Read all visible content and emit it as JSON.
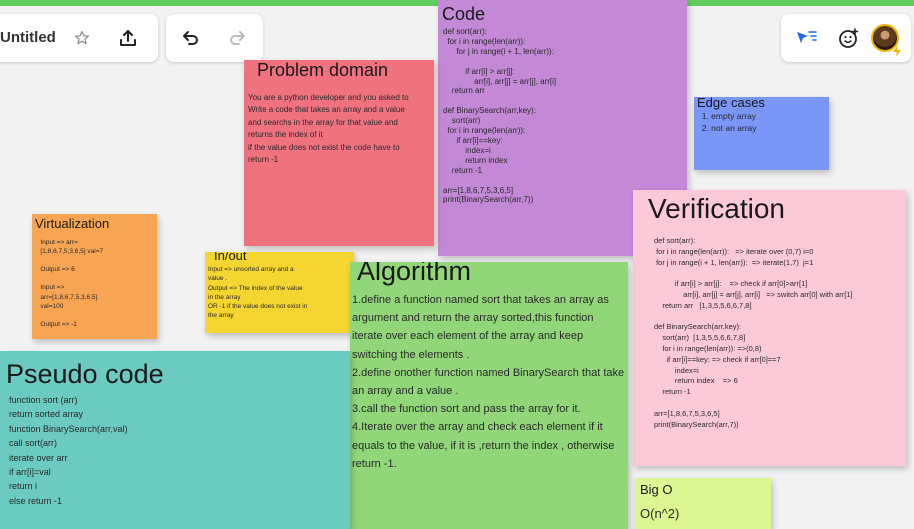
{
  "toolbar": {
    "board_title": "Untitled"
  },
  "notes": {
    "code": {
      "title": "Code",
      "body": "def sort(arr):\n  for i in range(len(arr)):\n      for j in range(i + 1, len(arr)):\n\n          if arr[i] > arr[j]:\n              arr[i], arr[j] = arr[j], arr[i]\n    return arr\n\ndef BinarySearch(arr,key):\n    sort(arr)\n  for i in range(len(arr)):\n      if arr[i]==key:\n          index=i\n          return index\n    return -1\n\narr=[1,8,6,7,5,3,6,5]\nprint(BinarySearch(arr,7))"
    },
    "problem": {
      "title": "Problem domain",
      "body": "You are a python developer and you asked to\nWrite a code that takes an array and a value\nand searchs in the array for that value and\nreturns the index of it\nif the value does not exist the code have to\nreturn -1"
    },
    "edge": {
      "title": "Edge cases",
      "body": "  1. empty array\n  2. not an array"
    },
    "virtualization": {
      "title": "Virtualization",
      "body": "   Input => arr=\n   [1,8,6,7,5,3,6,5] val=7\n\n   Output => 6\n\n   Input =>\n   arr=[1,8,6,7,5,3,6,5]\n   val=100\n\n   Output => -1"
    },
    "inout": {
      "title": "In/out",
      "body": "Input => unsorted array and a\nvalue .\nOutput => The index of the value\nin the array\nOR -1 if the value does not exist in\nthe array"
    },
    "algorithm": {
      "title": "Algorithm",
      "body": "1.define a function named sort that takes an array as argument and return the array sorted,this function iterate over each element of the array and keep switching the elements .\n2.define onother function named BinarySearch that take an array and a value .\n3.call the function sort and pass the array for it.\n4.Iterate over the array and check each element if it equals to the value, if it is ,return the index , otherwise return -1."
    },
    "verification": {
      "title": "Verification",
      "body": "def sort(arr):\n for i in range(len(arr)):   => iterate over (0,7) i=0\n for j in range(i + 1, len(arr)):  => iterate(1,7)  j=1\n\n          if arr[i] > arr[j]:    => check if arr[0]>arr[1]\n              arr[i], arr[j] = arr[j], arr[i]   => switch arr[0] with arr[1]\n    return arr   [1,3,5,5,6,6,7,8]\n\ndef BinarySearch(arr,key):\n    sort(arr)  [1,3,5,5,6,6,7,8]\n    for i in range(len(arr)): =>(0,8)\n      if arr[i]==key: => check if arr[0]==7\n          index=i\n          return index    => 6\n    return -1\n\narr=[1,8,6,7,5,3,6,5]\nprint(BinarySearch(arr,7))"
    },
    "pseudo": {
      "title": "Pseudo code",
      "body": "function sort (arr)\nreturn sorted array\nfunction BinarySearch(arr,val)\ncall sort(arr)\niterate over arr\nif arr[i]=val\nreturn i\nelse return -1"
    },
    "bigo": {
      "title": "Big O",
      "body": "O(n^2)"
    }
  },
  "colors": {
    "code": "#c389d6",
    "problem": "#f0727f",
    "edge": "#7a96f7",
    "virtualization": "#f7a552",
    "inout": "#f5d530",
    "algorithm": "#92d67a",
    "verification": "#fcc9d9",
    "pseudo": "#6bcbc3",
    "bigo": "#dcf791"
  }
}
